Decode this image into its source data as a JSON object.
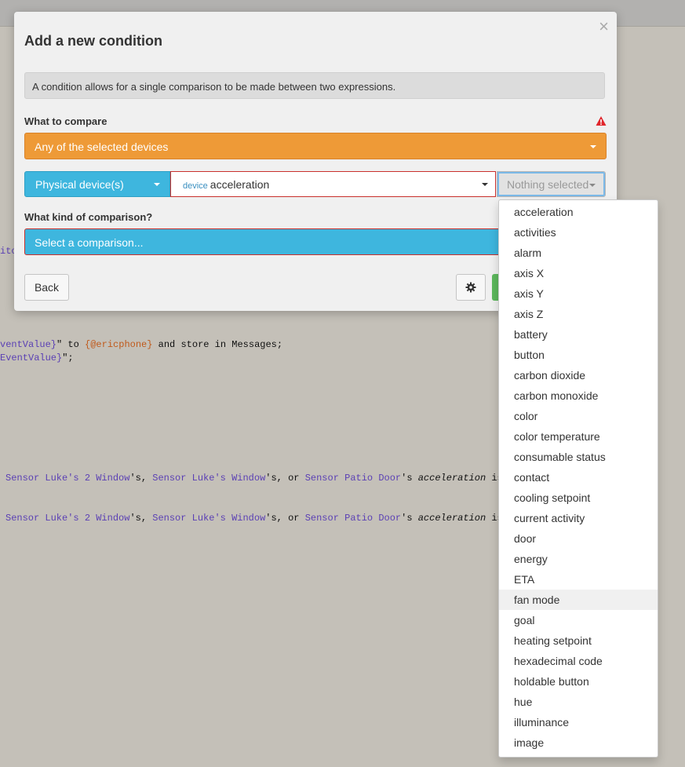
{
  "background_code": {
    "fragment_ito": "ito",
    "line1_a": "ventValue}",
    "line1_b": "\" to ",
    "line1_c": "{@ericphone}",
    "line1_d": " and store in Messages;",
    "line2_a": "EventValue}",
    "line2_b": "\";",
    "rows": [
      {
        "s1": "Sensor Luke's 2 Window",
        "t1": "'s, ",
        "s2": "Sensor Luke's Window",
        "t2": "'s, or ",
        "s3": "Sensor Patio Door",
        "t3": "'s ",
        "attr": "acceleration",
        "tail": " is"
      },
      {
        "s1": "Sensor Luke's 2 Window",
        "t1": "'s, ",
        "s2": "Sensor Luke's Window",
        "t2": "'s, or ",
        "s3": "Sensor Patio Door",
        "t3": "'s ",
        "attr": "acceleration",
        "tail": " is"
      }
    ]
  },
  "modal": {
    "title": "Add a new condition",
    "close_glyph": "×",
    "info_text": "A condition allows for a single comparison to be made between two expressions.",
    "compare_label": "What to compare",
    "compare_select_value": "Any of the selected devices",
    "device_type_value": "Physical device(s)",
    "attribute_prefix": "device",
    "attribute_value": "acceleration",
    "nothing_selected": "Nothing selected",
    "comparison_label": "What kind of comparison?",
    "comparison_placeholder": "Select a comparison...",
    "back_label": "Back"
  },
  "dropdown": {
    "items": [
      "acceleration",
      "activities",
      "alarm",
      "axis X",
      "axis Y",
      "axis Z",
      "battery",
      "button",
      "carbon dioxide",
      "carbon monoxide",
      "color",
      "color temperature",
      "consumable status",
      "contact",
      "cooling setpoint",
      "current activity",
      "door",
      "energy",
      "ETA",
      "fan mode",
      "goal",
      "heating setpoint",
      "hexadecimal code",
      "holdable button",
      "hue",
      "illuminance",
      "image"
    ],
    "highlighted": "fan mode"
  },
  "colors": {
    "orange": "#ee9a37",
    "blue": "#3eb6de",
    "green": "#5cb85c",
    "warning": "#e0262c"
  },
  "icons": [
    "close-icon",
    "warning-icon",
    "gear-icon",
    "caret-down-icon"
  ]
}
